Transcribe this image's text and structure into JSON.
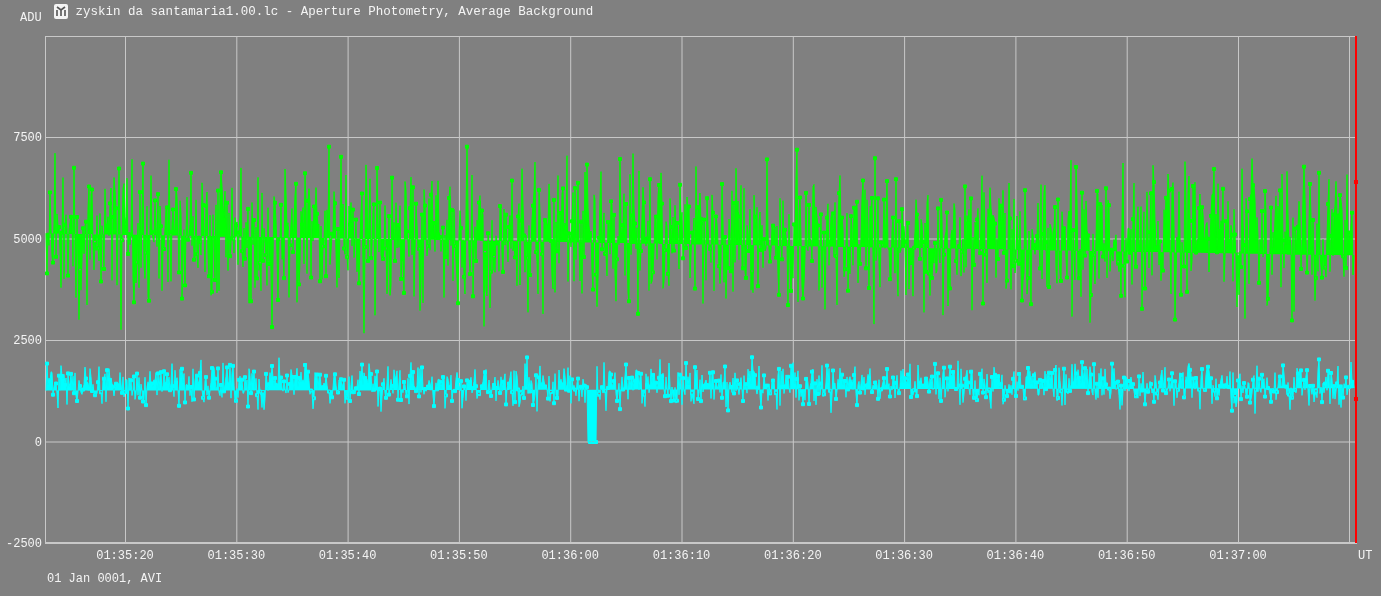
{
  "window": {
    "title": "zyskin da santamaria1.00.lc - Aperture Photometry, Average Background"
  },
  "plot": {
    "y_unit": "ADU",
    "x_unit": "UT",
    "y_ticks": [
      {
        "label": "7500",
        "kind": "major"
      },
      {
        "label": "5000",
        "kind": "major"
      },
      {
        "label": "2500",
        "kind": "major"
      },
      {
        "label": "0",
        "kind": "major"
      },
      {
        "label": "-2500",
        "kind": "major"
      }
    ],
    "x_ticks": [
      "01:35:20",
      "01:35:30",
      "01:35:40",
      "01:35:50",
      "01:36:00",
      "01:36:10",
      "01:36:20",
      "01:36:30",
      "01:36:40",
      "01:36:50",
      "01:37:00"
    ],
    "traces": [
      {
        "kind": "trace",
        "color": "#00ff00"
      },
      {
        "kind": "trace",
        "color": "#00ffff"
      }
    ],
    "cursor": {
      "color": "#ff0000"
    }
  },
  "footer": "01 Jan 0001, AVI"
}
